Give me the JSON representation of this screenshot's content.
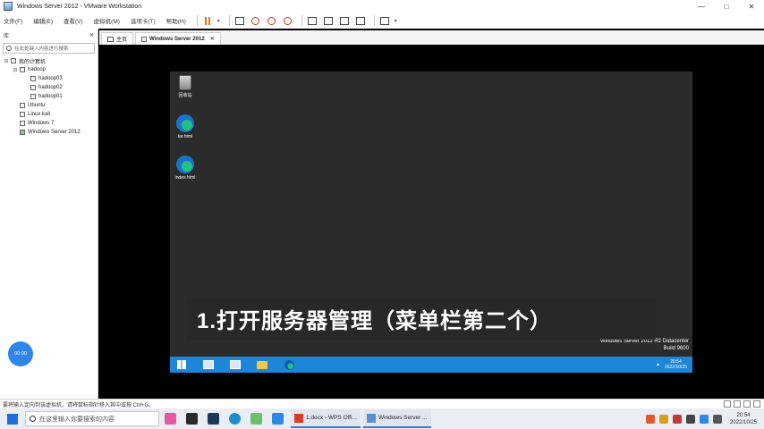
{
  "window": {
    "title": "Windows Server 2012 - VMware Workstation",
    "controls": [
      "—",
      "□",
      "✕"
    ]
  },
  "menu": [
    "文件(F)",
    "编辑(E)",
    "查看(V)",
    "虚拟机(M)",
    "选项卡(T)",
    "帮助(H)"
  ],
  "library": {
    "title": "库",
    "close": "✕",
    "search_placeholder": "在此处键入内容进行搜索",
    "tree": [
      {
        "label": "我的计算机",
        "level": 0,
        "expander": "⊟"
      },
      {
        "label": "hadoop",
        "level": 1,
        "expander": "⊟"
      },
      {
        "label": "hadoop03",
        "level": 2
      },
      {
        "label": "hadoop02",
        "level": 2
      },
      {
        "label": "hadoop01",
        "level": 2
      },
      {
        "label": "Ubuntu",
        "level": 1
      },
      {
        "label": "Linux kali",
        "level": 1
      },
      {
        "label": "Windows 7",
        "level": 1
      },
      {
        "label": "Windows Server 2012",
        "level": 1
      }
    ],
    "badge": "00:00"
  },
  "tabs": [
    {
      "label": "主页",
      "active": false
    },
    {
      "label": "Windows Server 2012",
      "active": true,
      "close": "✕"
    }
  ],
  "guest": {
    "desktop_icons": [
      {
        "label": "回收站",
        "kind": "bin"
      },
      {
        "label": "tar.html",
        "kind": "edge"
      },
      {
        "label": "index.html",
        "kind": "edge"
      }
    ],
    "caption": "1.打开服务器管理（菜单栏第二个）",
    "watermark_line1": "Windows Server 2012 R2 Datacenter",
    "watermark_line2": "Build 9600",
    "clock_time": "20:54",
    "clock_date": "2022/10/25"
  },
  "status_text": "要将输入定向到该虚拟机，请将鼠标指针移入其中或按 Ctrl+G。",
  "host_taskbar": {
    "search_placeholder": "在这里输入你要搜索的内容",
    "apps": [
      {
        "label": "1.docx - WPS Offi...",
        "color": "#d83b2c"
      },
      {
        "label": "Windows Server ...",
        "color": "#5a8fd0"
      }
    ],
    "clock_time": "20:54",
    "clock_date": "2022/10/25"
  }
}
